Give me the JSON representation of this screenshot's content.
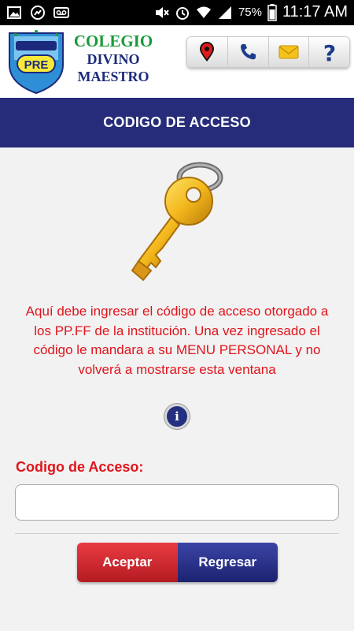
{
  "status_bar": {
    "battery": "75%",
    "time": "11:17 AM",
    "icons": [
      "gallery-icon",
      "signal-icon",
      "voicemail-icon",
      "mute-icon",
      "alarm-icon",
      "wifi-icon",
      "cell-signal-icon",
      "battery-icon"
    ]
  },
  "header": {
    "school_line1": "COLEGIO",
    "school_line2": "DIVINO",
    "school_line3": "MAESTRO",
    "logo_text": "LA PRE",
    "actions": [
      {
        "name": "location-pin-icon"
      },
      {
        "name": "phone-icon"
      },
      {
        "name": "envelope-icon"
      },
      {
        "name": "help-icon"
      }
    ]
  },
  "title": "CODIGO DE ACCESO",
  "message": "Aquí debe ingresar el código de acceso otorgado a los PP.FF de la institución. Una vez ingresado el código le mandara a su MENU PERSONAL y no volverá a mostrarse esta ventana",
  "info_icon": "i",
  "form": {
    "label": "Codigo de Acceso:",
    "value": "",
    "placeholder": ""
  },
  "buttons": {
    "accept": "Aceptar",
    "back": "Regresar"
  },
  "colors": {
    "title_bar": "#262c7a",
    "message_text": "#e0141b",
    "accept_button": "#d62a31",
    "back_button": "#262c7a"
  }
}
